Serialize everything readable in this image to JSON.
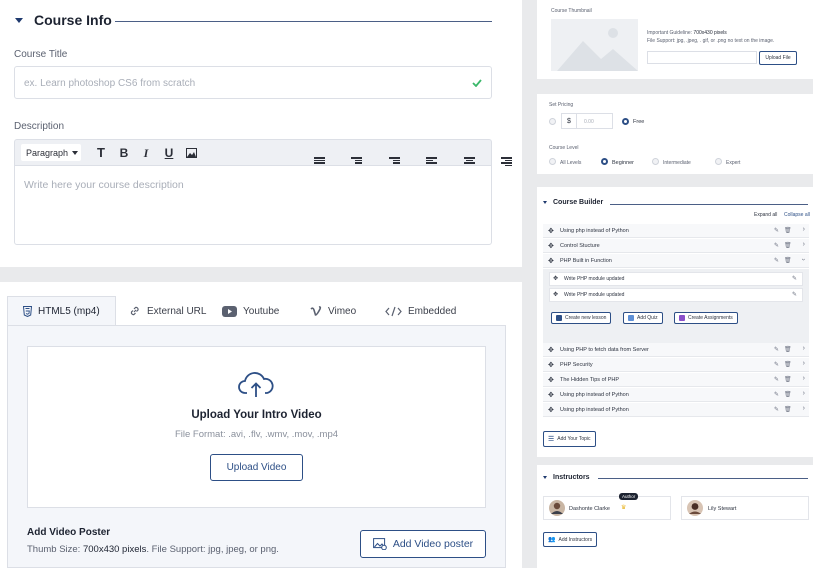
{
  "course_info": {
    "title": "Course Info",
    "course_title_label": "Course Title",
    "course_title_placeholder": "ex. Learn photoshop CS6 from scratch",
    "description_label": "Description",
    "paragraph_select": "Paragraph",
    "description_placeholder": "Write here your course description",
    "toolbar": {
      "text": "T",
      "bold": "B",
      "italic": "I",
      "underline": "U"
    }
  },
  "video": {
    "tabs": [
      {
        "label": "HTML5 (mp4)",
        "icon": "html5-icon"
      },
      {
        "label": "External URL",
        "icon": "link-icon"
      },
      {
        "label": "Youtube",
        "icon": "youtube-icon"
      },
      {
        "label": "Vimeo",
        "icon": "vimeo-icon"
      },
      {
        "label": "Embedded",
        "icon": "code-icon"
      }
    ],
    "upload_title": "Upload Your Intro Video",
    "file_format": "File Format: .avi, .flv, .wmv, .mov, .mp4",
    "upload_button": "Upload Video",
    "poster_title": "Add Video Poster",
    "poster_size_prefix": "Thumb Size: ",
    "poster_size_value": "700x430 pixels",
    "poster_support": ". File Support: jpg, jpeg, or png.",
    "poster_button": "Add Video poster"
  },
  "thumbnail": {
    "label": "Course Thumbnail",
    "guideline_prefix": "Important Guideline: ",
    "guideline_value": "700x430 pixels",
    "support": "File Support: jpg, .jpeg, . gif, or .png  no text on the image.",
    "upload_button": "Upload File"
  },
  "pricing": {
    "label": "Set Pricing",
    "currency": "$",
    "amount_placeholder": "0.00",
    "free_label": "Free",
    "level_label": "Course Level",
    "levels": [
      "All Levels",
      "Beginner",
      "Intermediate",
      "Expert"
    ],
    "selected_level": "Beginner"
  },
  "builder": {
    "title": "Course Builder",
    "expand_all": "Expand all",
    "collapse_all": "Collapse all",
    "topics_top": [
      "Using php instead of Python",
      "Control Stucture",
      "PHP Built in Function"
    ],
    "lessons": [
      "Write PHP module updated",
      "Write PHP module updated"
    ],
    "actions": [
      "Create new lesson",
      "Add Quiz",
      "Create Assignments"
    ],
    "topics_bottom": [
      "Using PHP to fetch data from Server",
      "PHP Security",
      "The Hidden Tips of PHP",
      "Using php instead of Python",
      "Using php instead of Python"
    ],
    "add_topic": "Add Your Topic"
  },
  "instructors": {
    "title": "Instructors",
    "badge": "Author",
    "people": [
      "Dashonte Clarke",
      "Lily Stewart"
    ],
    "add_button": "Add Instructors"
  },
  "colors": {
    "brand": "#2d4f86",
    "success": "#3bb86a"
  }
}
